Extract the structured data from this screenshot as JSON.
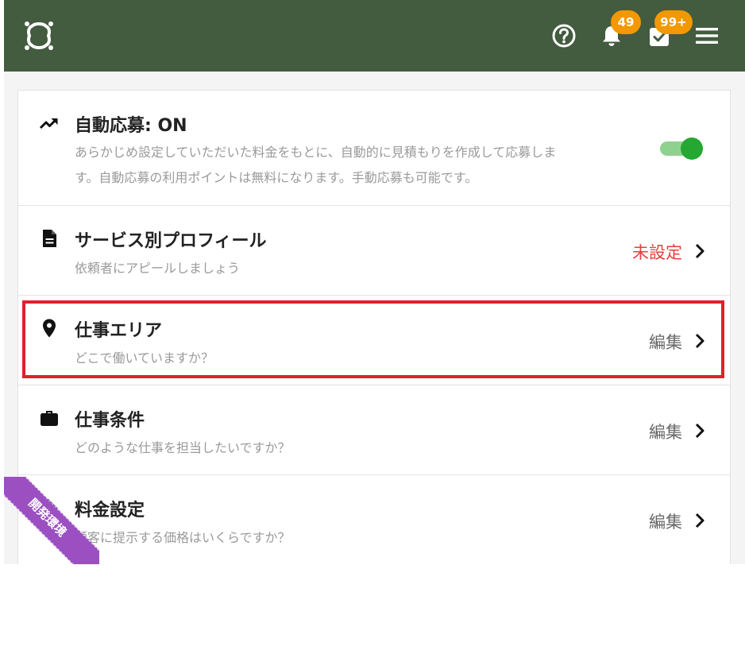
{
  "header": {
    "badges": {
      "notifications": "49",
      "tasks": "99+"
    },
    "colors": {
      "background": "#435b3f",
      "badge": "#f39800"
    },
    "icons": [
      "logo-icon",
      "help-icon",
      "bell-icon",
      "task-check-icon",
      "hamburger-menu-icon"
    ]
  },
  "settings": {
    "auto_apply": {
      "title": "自動応募: ON",
      "description_line1": "あらかじめ設定していただいた料金をもとに、自動的に見積もりを作成して応募しま",
      "description_line2": "す。自動応募の利用ポイントは無料になります。手動応募も可能です。",
      "enabled": true,
      "icon": "trending-up-icon"
    },
    "service_profile": {
      "title": "サービス別プロフィール",
      "description": "依頼者にアピールしましょう",
      "status": "未設定",
      "icon": "document-icon"
    },
    "work_area": {
      "title": "仕事エリア",
      "description": "どこで働いていますか？",
      "status": "編集",
      "icon": "location-pin-icon"
    },
    "work_conditions": {
      "title": "仕事条件",
      "description": "どのような仕事を担当したいですか？",
      "status": "編集",
      "icon": "briefcase-icon"
    },
    "pricing": {
      "title": "料金設定",
      "description": "顧客に提示する価格はいくらですか？",
      "status": "編集",
      "icon": "tag-icon"
    }
  },
  "environment_ribbon": {
    "label": "開発環境",
    "color": "#9b4fc1"
  },
  "colors": {
    "unset_status": "#e83e3e",
    "toggle_on": "#24a832",
    "highlight": "#e0202c"
  }
}
